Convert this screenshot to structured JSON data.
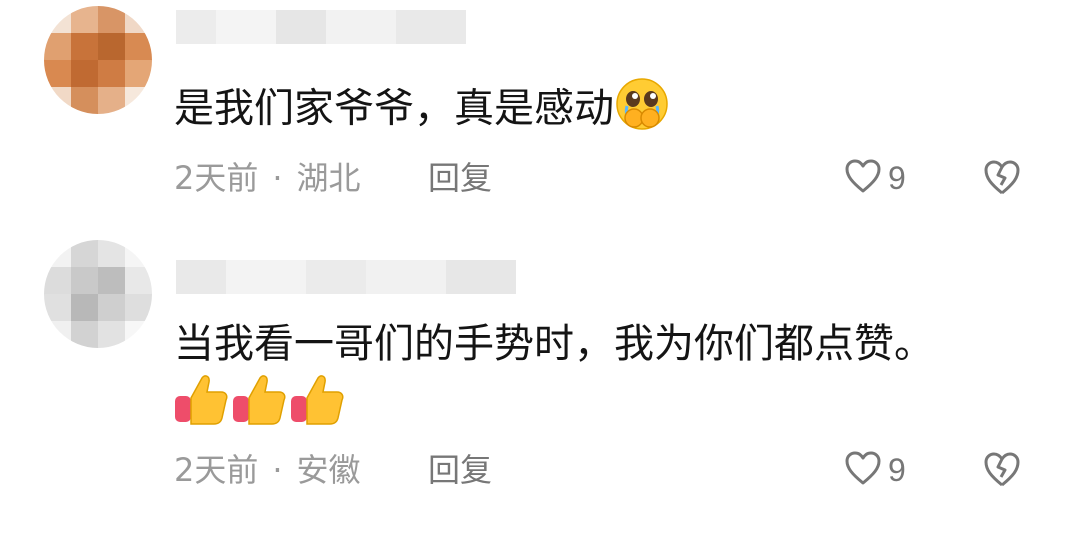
{
  "comments": [
    {
      "text": "是我们家爷爷，真是感动",
      "emoji": "pleading-face-hands-over-mouth",
      "time": "2天前",
      "location": "湖北",
      "reply_label": "回复",
      "likes": "9"
    },
    {
      "text": "当我看一哥们的手势时，我为你们都点赞。",
      "emoji": "thumbs-up",
      "emoji_count": 3,
      "time": "2天前",
      "location": "安徽",
      "reply_label": "回复",
      "likes": "9"
    }
  ],
  "separator": "·",
  "colors": {
    "meta_text": "#9a9a9a",
    "action_text": "#777777",
    "avatar1": "#c8733a",
    "avatar2": "#d8d8d8"
  }
}
